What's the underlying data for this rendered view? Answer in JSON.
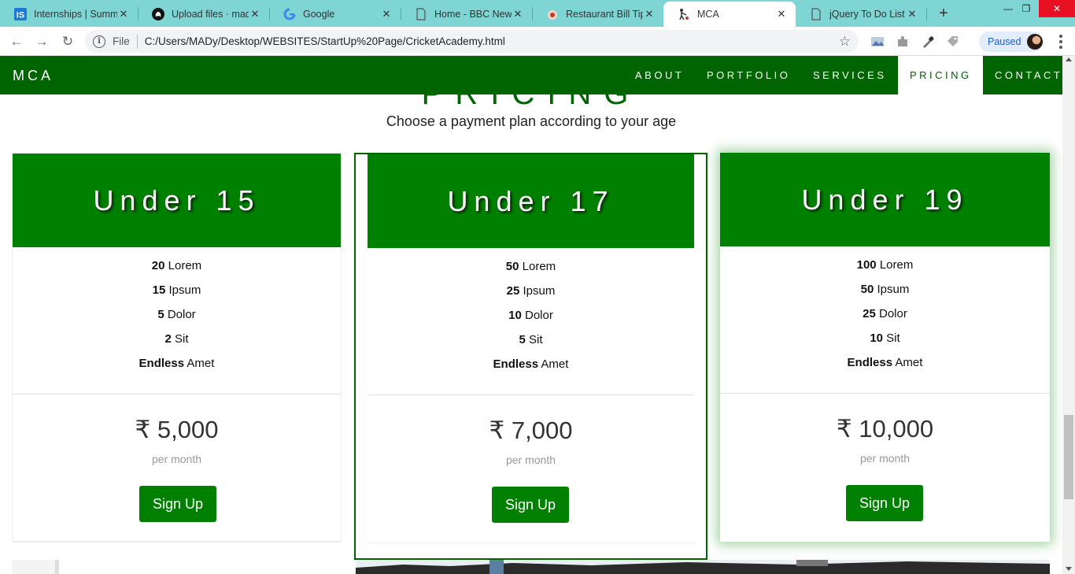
{
  "browser": {
    "tabs": [
      {
        "title": "Internships | Summ",
        "favicon": "internshala-icon"
      },
      {
        "title": "Upload files · madh",
        "favicon": "github-icon"
      },
      {
        "title": "Google",
        "favicon": "google-icon"
      },
      {
        "title": "Home - BBC News",
        "favicon": "document-icon"
      },
      {
        "title": "Restaurant Bill Tip C",
        "favicon": "restaurant-icon"
      },
      {
        "title": "MCA",
        "favicon": "cricket-icon"
      },
      {
        "title": "jQuery To Do List",
        "favicon": "document-icon"
      }
    ],
    "active_tab_index": 5,
    "omnibox": {
      "scheme_label": "File",
      "url": "C:/Users/MADy/Desktop/WEBSITES/StartUp%20Page/CricketAcademy.html"
    },
    "profile_label": "Paused"
  },
  "site": {
    "brand": "MCA",
    "nav": [
      {
        "label": "ABOUT",
        "active": false
      },
      {
        "label": "PORTFOLIO",
        "active": false
      },
      {
        "label": "SERVICES",
        "active": false
      },
      {
        "label": "PRICING",
        "active": true
      },
      {
        "label": "CONTACT",
        "active": false
      }
    ],
    "section_title": "PRICING",
    "section_subtitle": "Choose a payment plan according to your age",
    "colors": {
      "nav_bg": "#006400",
      "card_head_bg": "#008000",
      "button_bg": "#008000"
    },
    "plans": [
      {
        "title": "Under 15",
        "features": [
          {
            "value": "20",
            "label": "Lorem"
          },
          {
            "value": "15",
            "label": "Ipsum"
          },
          {
            "value": "5",
            "label": "Dolor"
          },
          {
            "value": "2",
            "label": "Sit"
          },
          {
            "value": "Endless",
            "label": "Amet"
          }
        ],
        "price": "₹ 5,000",
        "period": "per month",
        "cta": "Sign Up"
      },
      {
        "title": "Under 17",
        "features": [
          {
            "value": "50",
            "label": "Lorem"
          },
          {
            "value": "25",
            "label": "Ipsum"
          },
          {
            "value": "10",
            "label": "Dolor"
          },
          {
            "value": "5",
            "label": "Sit"
          },
          {
            "value": "Endless",
            "label": "Amet"
          }
        ],
        "price": "₹ 7,000",
        "period": "per month",
        "cta": "Sign Up"
      },
      {
        "title": "Under 19",
        "features": [
          {
            "value": "100",
            "label": "Lorem"
          },
          {
            "value": "50",
            "label": "Ipsum"
          },
          {
            "value": "25",
            "label": "Dolor"
          },
          {
            "value": "10",
            "label": "Sit"
          },
          {
            "value": "Endless",
            "label": "Amet"
          }
        ],
        "price": "₹ 10,000",
        "period": "per month",
        "cta": "Sign Up"
      }
    ]
  }
}
